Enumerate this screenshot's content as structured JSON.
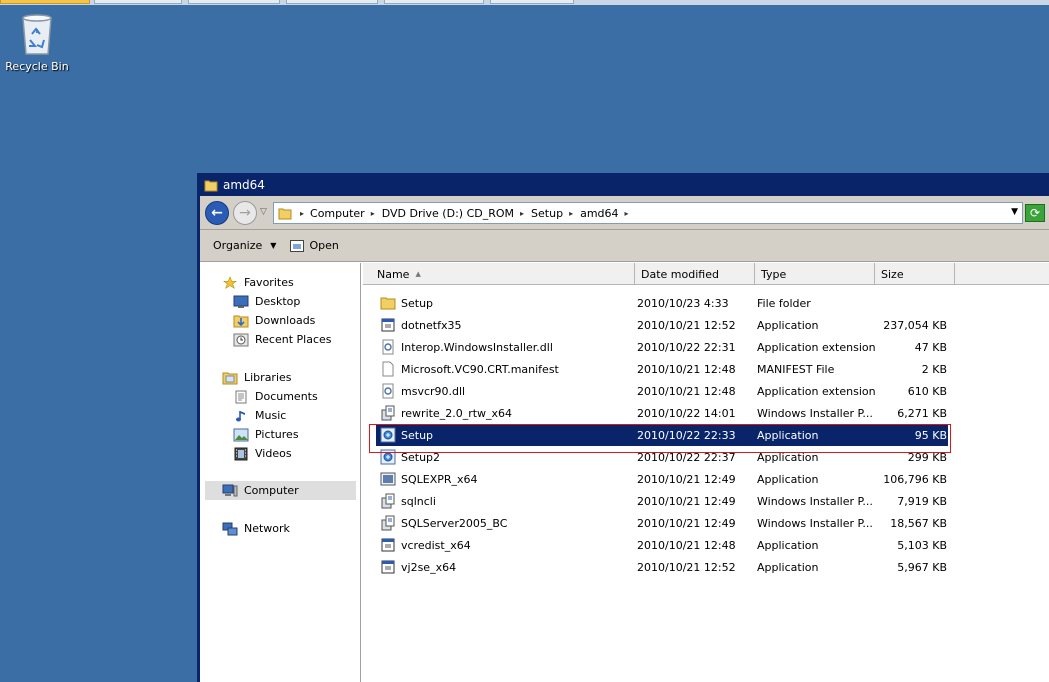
{
  "desktop": {
    "recycle_bin_label": "Recycle Bin"
  },
  "window": {
    "title": "amd64",
    "breadcrumb": [
      "Computer",
      "DVD Drive (D:) CD_ROM",
      "Setup",
      "amd64"
    ],
    "toolbar": {
      "organize_label": "Organize",
      "open_label": "Open"
    }
  },
  "nav": {
    "favorites": "Favorites",
    "desktop": "Desktop",
    "downloads": "Downloads",
    "recent_places": "Recent Places",
    "libraries": "Libraries",
    "documents": "Documents",
    "music": "Music",
    "pictures": "Pictures",
    "videos": "Videos",
    "computer": "Computer",
    "network": "Network"
  },
  "columns": {
    "name": "Name",
    "date": "Date modified",
    "type": "Type",
    "size": "Size"
  },
  "files": [
    {
      "name": "Setup",
      "date": "2010/10/23 4:33",
      "type": "File folder",
      "size": "",
      "icon": "folder-icon"
    },
    {
      "name": "dotnetfx35",
      "date": "2010/10/21 12:52",
      "type": "Application",
      "size": "237,054 KB",
      "icon": "application-icon"
    },
    {
      "name": "Interop.WindowsInstaller.dll",
      "date": "2010/10/22 22:31",
      "type": "Application extension",
      "size": "47 KB",
      "icon": "dll-icon"
    },
    {
      "name": "Microsoft.VC90.CRT.manifest",
      "date": "2010/10/21 12:48",
      "type": "MANIFEST File",
      "size": "2 KB",
      "icon": "manifest-file-icon"
    },
    {
      "name": "msvcr90.dll",
      "date": "2010/10/21 12:48",
      "type": "Application extension",
      "size": "610 KB",
      "icon": "dll-icon"
    },
    {
      "name": "rewrite_2.0_rtw_x64",
      "date": "2010/10/22 14:01",
      "type": "Windows Installer P...",
      "size": "6,271 KB",
      "icon": "installer-package-icon"
    },
    {
      "name": "Setup",
      "date": "2010/10/22 22:33",
      "type": "Application",
      "size": "95 KB",
      "icon": "setup-app-icon"
    },
    {
      "name": "Setup2",
      "date": "2010/10/22 22:37",
      "type": "Application",
      "size": "299 KB",
      "icon": "setup-app-icon"
    },
    {
      "name": "SQLEXPR_x64",
      "date": "2010/10/21 12:49",
      "type": "Application",
      "size": "106,796 KB",
      "icon": "sql-app-icon"
    },
    {
      "name": "sqlncli",
      "date": "2010/10/21 12:49",
      "type": "Windows Installer P...",
      "size": "7,919 KB",
      "icon": "installer-package-icon"
    },
    {
      "name": "SQLServer2005_BC",
      "date": "2010/10/21 12:49",
      "type": "Windows Installer P...",
      "size": "18,567 KB",
      "icon": "installer-package-icon"
    },
    {
      "name": "vcredist_x64",
      "date": "2010/10/21 12:48",
      "type": "Application",
      "size": "5,103 KB",
      "icon": "application-icon"
    },
    {
      "name": "vj2se_x64",
      "date": "2010/10/21 12:52",
      "type": "Application",
      "size": "5,967 KB",
      "icon": "application-icon"
    }
  ],
  "selected_file": "Setup",
  "colors": {
    "desktop": "#3a6ea5",
    "selection": "#0a246a",
    "highlight_outline": "#d41a1a"
  }
}
